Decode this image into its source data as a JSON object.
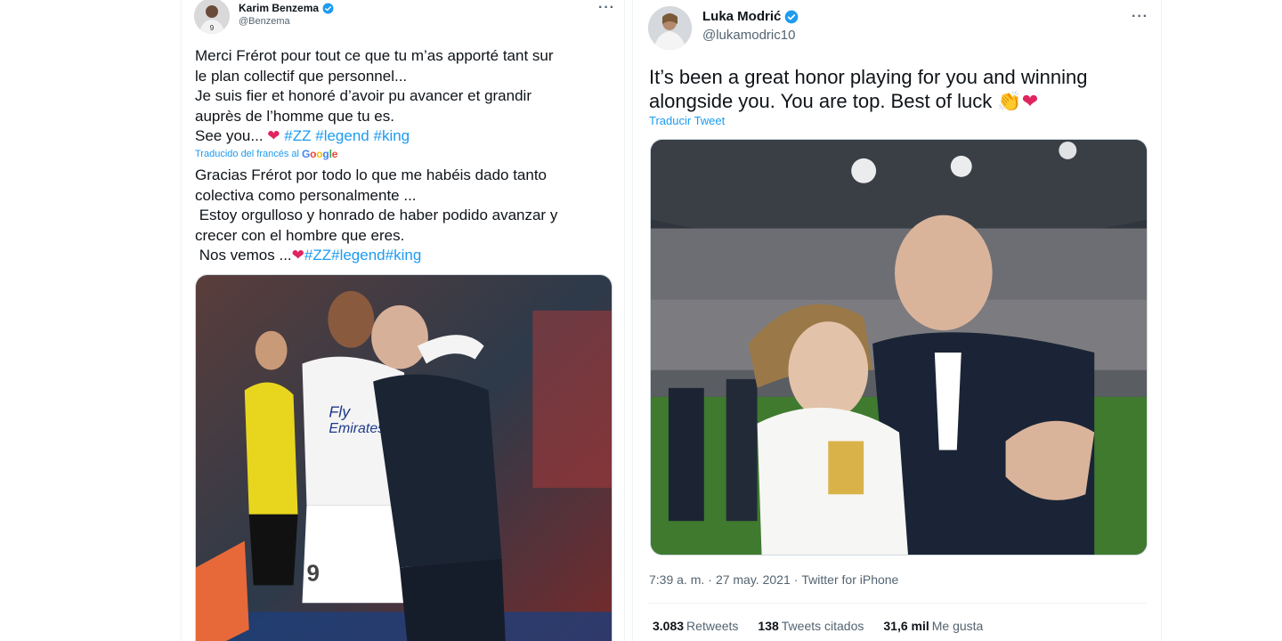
{
  "tweet_left": {
    "author_name": "Karim Benzema",
    "author_handle": "@Benzema",
    "more_icon": "···",
    "text_lines": [
      [
        "Merci Frérot pour tout ce que tu m’as apporté tant sur"
      ],
      [
        "le plan collectif que personnel..."
      ],
      [
        "Je suis fier et honoré d’avoir pu avancer et grandir"
      ],
      [
        "auprès de l’homme que tu es."
      ]
    ],
    "see_you": "See you... ",
    "heart": "❤",
    "hashtags_fr": [
      "#ZZ",
      "#legend",
      "#king"
    ],
    "translated_label": "Traducido del francés al",
    "google_letters": [
      "G",
      "o",
      "o",
      "g",
      "l",
      "e"
    ],
    "translation_lines": [
      "Gracias Frérot por todo lo que me habéis dado tanto",
      "colectiva como personalmente ...",
      " Estoy orgulloso y honrado de haber podido avanzar y",
      "crecer con el hombre que eres."
    ],
    "nos_vemos": " Nos vemos ...",
    "hashtags_es": [
      "#ZZ",
      "#legend",
      "#king"
    ]
  },
  "tweet_right": {
    "author_name": "Luka Modrić",
    "author_handle": "@lukamodric10",
    "more_icon": "···",
    "text_line_1": "It’s been a great honor playing for you and winning",
    "text_line_2": "alongside you. You are top. Best of luck ",
    "emojis": "👏❤",
    "translate_link": "Traducir Tweet",
    "time": "7:39 a. m.",
    "date": "27 may. 2021",
    "separator": "·",
    "client": "Twitter for iPhone",
    "retweets_count": "3.083",
    "retweets_label": "Retweets",
    "quotes_count": "138",
    "quotes_label": "Tweets citados",
    "likes_count": "31,6 mil",
    "likes_label": "Me gusta"
  },
  "colors": {
    "link": "#1d9bf0",
    "text": "#0f1419",
    "muted": "#536471",
    "heart": "#e0245e",
    "verified": "#1d9bf0"
  }
}
